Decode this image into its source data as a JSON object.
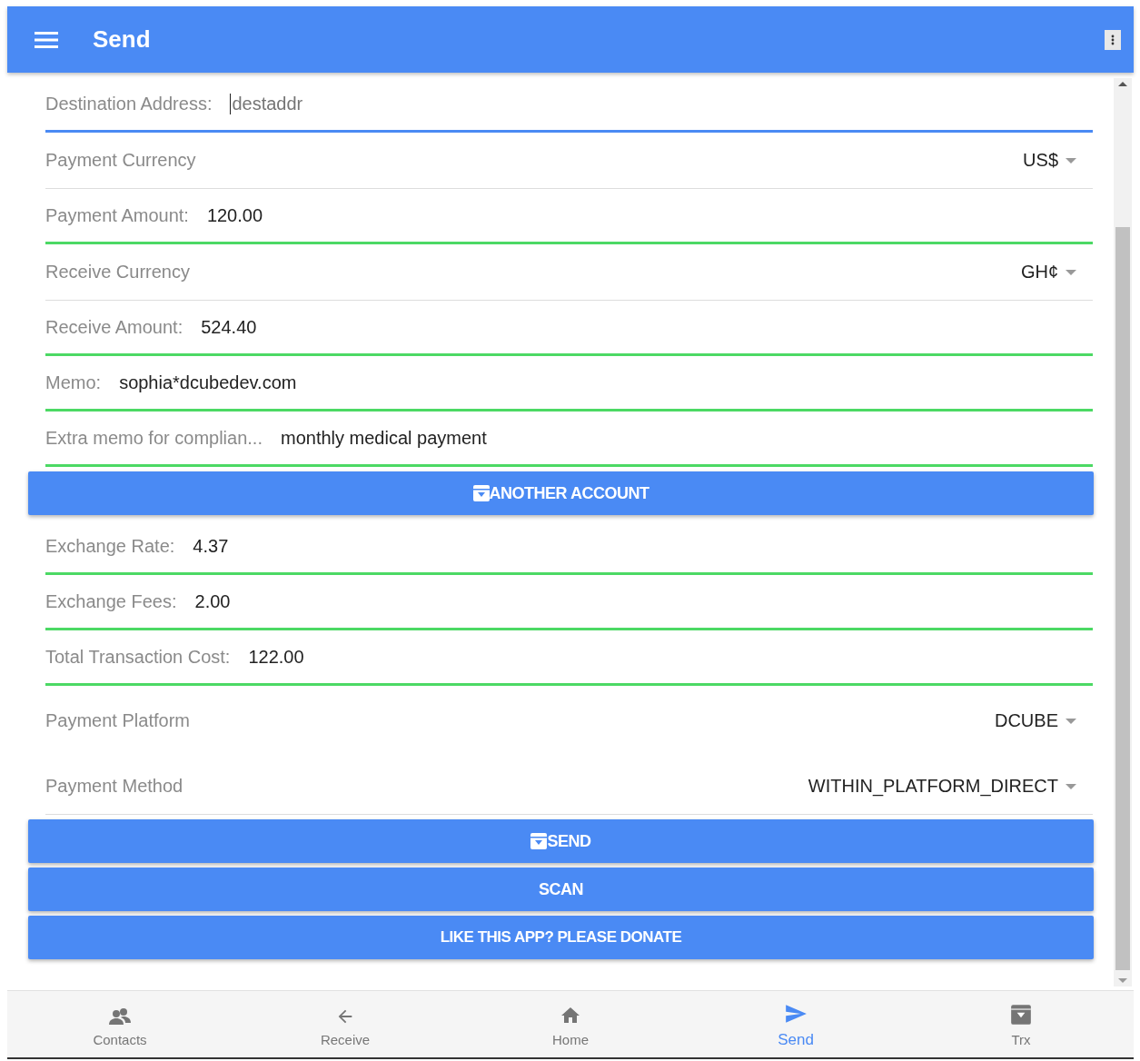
{
  "app_bar": {
    "title": "Send"
  },
  "form": [
    {
      "kind": "input",
      "label": "Destination Address:",
      "placeholder": "destaddr",
      "focused": true
    },
    {
      "kind": "select",
      "label": "Payment Currency",
      "value": "US$",
      "divider": true
    },
    {
      "kind": "input",
      "label": "Payment Amount:",
      "value": "120.00",
      "focused": false
    },
    {
      "kind": "select",
      "label": "Receive Currency",
      "value": "GH¢",
      "divider": true
    },
    {
      "kind": "input",
      "label": "Receive Amount:",
      "value": "524.40",
      "focused": false
    },
    {
      "kind": "input",
      "label": "Memo:",
      "value": "sophia*dcubedev.com",
      "focused": false
    },
    {
      "kind": "input",
      "label": "Extra memo for complian...",
      "value": "monthly medical payment",
      "focused": false
    },
    {
      "kind": "button",
      "label": "ANOTHER ACCOUNT",
      "icon": true
    },
    {
      "kind": "input",
      "label": "Exchange Rate:",
      "value": "4.37",
      "focused": false
    },
    {
      "kind": "input",
      "label": "Exchange Fees:",
      "value": "2.00",
      "focused": false
    },
    {
      "kind": "input",
      "label": "Total Transaction Cost:",
      "value": "122.00",
      "focused": false
    },
    {
      "kind": "select",
      "label": "Payment Platform",
      "value": "DCUBE",
      "divider": false
    },
    {
      "kind": "select",
      "label": "Payment Method",
      "value": "WITHIN_PLATFORM_DIRECT",
      "divider": true
    },
    {
      "kind": "button",
      "label": "SEND",
      "icon": true
    },
    {
      "kind": "button",
      "label": "SCAN",
      "icon": false
    },
    {
      "kind": "button",
      "label": "LIKE THIS APP? PLEASE DONATE",
      "icon": false
    }
  ],
  "bottom_nav": [
    {
      "kind": "contacts",
      "label": "Contacts",
      "selected": false
    },
    {
      "kind": "receive",
      "label": "Receive",
      "selected": false
    },
    {
      "kind": "home",
      "label": "Home",
      "selected": false
    },
    {
      "kind": "send",
      "label": "Send",
      "selected": true
    },
    {
      "kind": "trx",
      "label": "Trx",
      "selected": false
    }
  ]
}
